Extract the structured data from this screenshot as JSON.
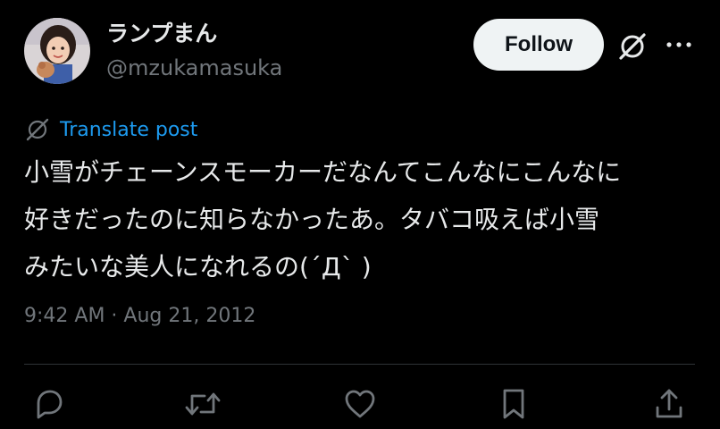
{
  "user": {
    "display_name": "ランプまん",
    "handle": "@mzukamasuka"
  },
  "header": {
    "follow_label": "Follow",
    "grok_icon": "grok-icon",
    "more_icon": "more-icon"
  },
  "translate": {
    "label": "Translate post",
    "icon": "translate-globe-icon"
  },
  "tweet": {
    "lines": [
      "小雪がチェーンスモーカーだなんてこんなにこんなに",
      "好きだったのに知らなかったあ。タバコ吸えば小雪",
      "みたいな美人になれるの(´Д` )"
    ]
  },
  "meta": {
    "timestamp": "9:42 AM · Aug 21, 2012"
  },
  "actions": {
    "icons": [
      "reply-icon",
      "repost-icon",
      "like-icon",
      "bookmark-icon",
      "share-icon"
    ]
  },
  "colors": {
    "background": "#000000",
    "text": "#e7e9ea",
    "muted": "#71767b",
    "link": "#1d9bf0",
    "follow_bg": "#eff3f4",
    "divider": "#2f3336"
  }
}
